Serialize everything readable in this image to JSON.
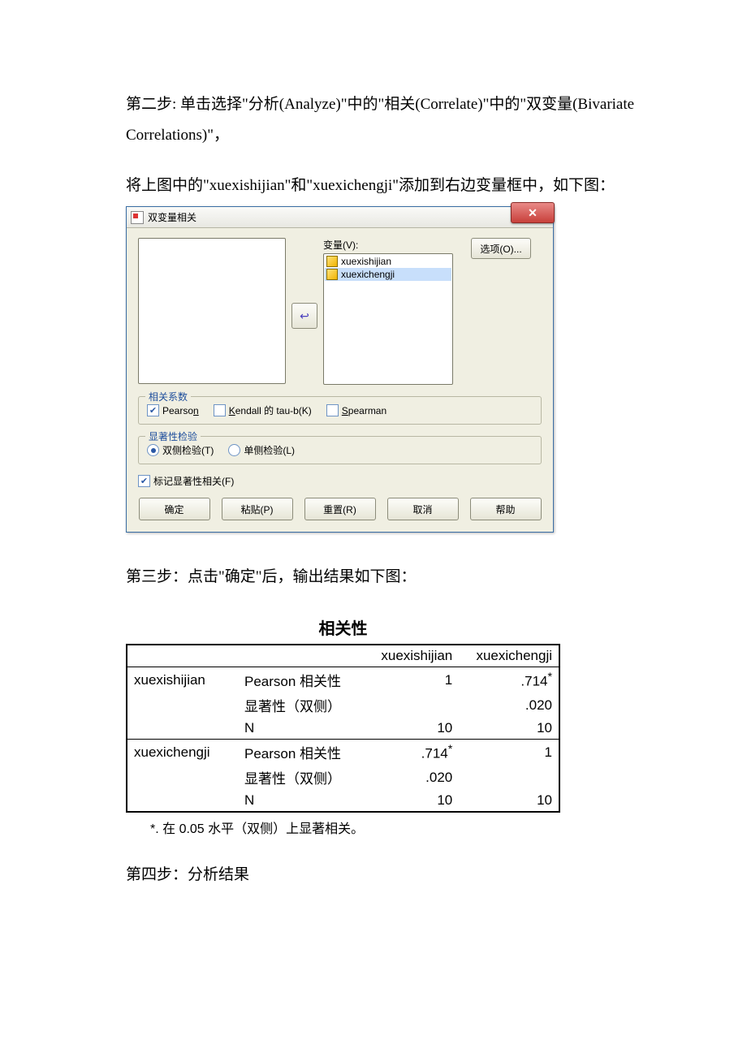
{
  "step2_text": "第二步: 单击选择\"分析(Analyze)\"中的\"相关(Correlate)\"中的\"双变量(Bivariate Correlations)\"，",
  "add_text": "将上图中的\"xuexishijian\"和\"xuexichengji\"添加到右边变量框中，如下图：",
  "dialog": {
    "title": "双变量相关",
    "var_label": "变量(V):",
    "vars": [
      "xuexishijian",
      "xuexichengji"
    ],
    "opt_btn": "选项(O)...",
    "arrow": "↩",
    "coeff_legend": "相关系数",
    "pearson": "Pearson",
    "kendall": "Kendall 的 tau-b(K)",
    "spearman": "Spearman",
    "sig_legend": "显著性检验",
    "two_tail": "双侧检验(T)",
    "one_tail": "单侧检验(L)",
    "flag": "标记显著性相关(F)",
    "btn_ok": "确定",
    "btn_paste": "粘贴(P)",
    "btn_reset": "重置(R)",
    "btn_cancel": "取消",
    "btn_help": "帮助"
  },
  "step3_text": "第三步：点击\"确定\"后，输出结果如下图：",
  "output": {
    "title": "相关性",
    "col1": "xuexishijian",
    "col2": "xuexichengji",
    "row_pearson": "Pearson 相关性",
    "row_sig": "显著性（双侧）",
    "row_n": "N",
    "v_714": ".714",
    "v_star": "*",
    "v_020": ".020",
    "v_10": "10",
    "v_1": "1",
    "footnote": "*. 在 0.05 水平（双侧）上显著相关。"
  },
  "step4_text": "第四步：分析结果"
}
